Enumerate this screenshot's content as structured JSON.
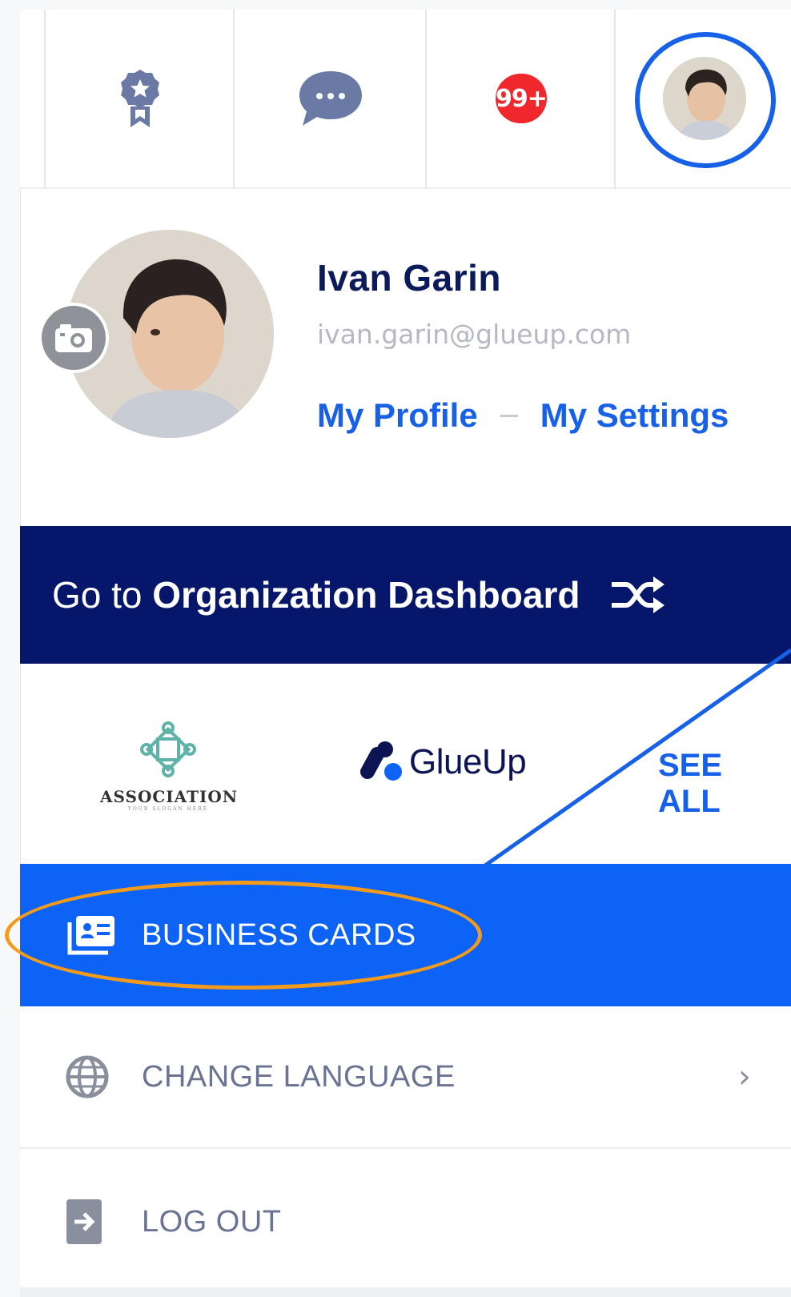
{
  "topbar": {
    "notifications_badge": "99+",
    "icons": [
      "award-icon",
      "chat-bubble-icon",
      "notifications-badge",
      "avatar"
    ]
  },
  "profile": {
    "name": "Ivan Garin",
    "email": "ivan.garin@glueup.com",
    "my_profile_label": "My Profile",
    "my_settings_label": "My Settings"
  },
  "org_dashboard": {
    "prefix": "Go to",
    "label": "Organization Dashboard"
  },
  "organizations": {
    "association_name": "ASSOCIATION",
    "association_slogan": "YOUR SLOGAN HERE",
    "glueup_name": "GlueUp",
    "see_all_label": "SEE ALL"
  },
  "menu": {
    "business_cards": "BUSINESS CARDS",
    "change_language": "CHANGE LANGUAGE",
    "log_out": "LOG OUT"
  },
  "colors": {
    "primary_blue": "#0c63f5",
    "navy": "#06166b",
    "badge_red": "#f0282d",
    "annotation_orange": "#f39a1b",
    "annotation_blue": "#1760e8"
  }
}
